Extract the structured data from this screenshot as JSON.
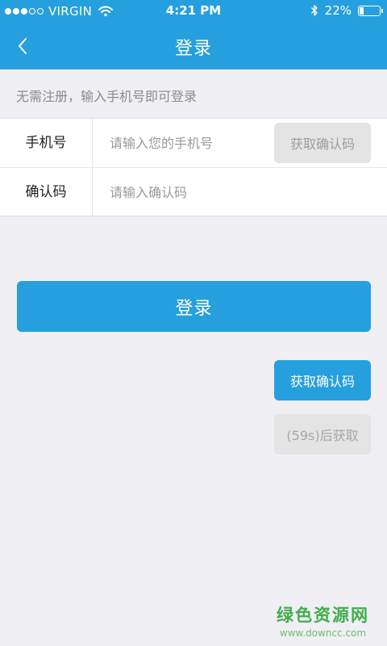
{
  "status_bar": {
    "carrier": "VIRGIN",
    "time": "4:21 PM",
    "battery": "22%",
    "battery_level": 0.22,
    "icons": [
      "signal-dots-icon",
      "wifi-icon",
      "bluetooth-icon",
      "battery-icon"
    ]
  },
  "nav": {
    "title": "登录",
    "back_icon": "chevron-left-icon"
  },
  "hint": "无需注册，输入手机号即可登录",
  "form": {
    "phone": {
      "label": "手机号",
      "placeholder": "请输入您的手机号",
      "value": "",
      "get_code_label": "获取确认码"
    },
    "code": {
      "label": "确认码",
      "placeholder": "请输入确认码",
      "value": ""
    }
  },
  "login_button": "登录",
  "code_buttons": {
    "active_label": "获取确认码",
    "countdown_label": "(59s)后获取"
  },
  "watermark": {
    "name": "绿色资源网",
    "url": "www.downcc.com"
  },
  "colors": {
    "primary": "#269fde",
    "background": "#efeff4",
    "disabled": "#e4e4e4"
  }
}
